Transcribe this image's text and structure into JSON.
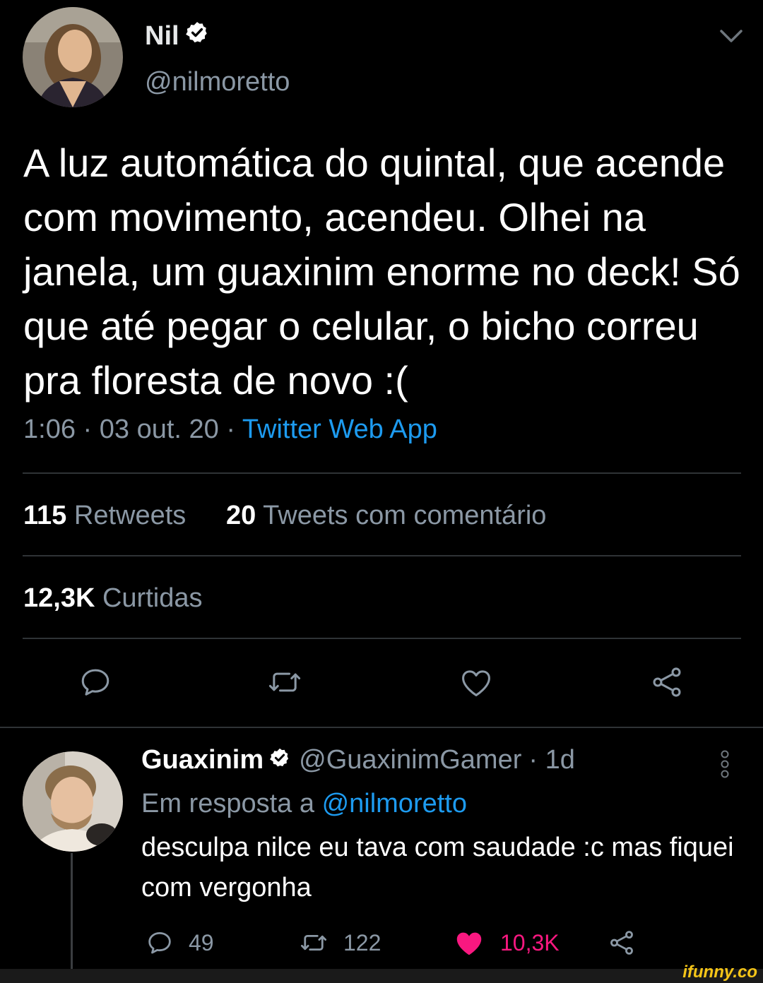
{
  "main_tweet": {
    "author_name": "Nil",
    "author_handle": "@nilmoretto",
    "text": "A luz automática do quintal, que acende com movimento, acendeu. Olhei na janela, um guaxinim enorme no deck! Só que até pegar o celular, o bicho correu pra floresta de novo :(",
    "time": "1:06",
    "date": "03 out. 20",
    "separator": "·",
    "source": "Twitter Web App",
    "retweets_count": "115",
    "retweets_label": "Retweets",
    "quote_count": "20",
    "quote_label": "Tweets com comentário",
    "likes_count": "12,3K",
    "likes_label": "Curtidas"
  },
  "reply": {
    "author_name": "Guaxinim",
    "author_handle": "@GuaxinimGamer",
    "age": "· 1d",
    "reply_to_label": "Em resposta a",
    "reply_to_handle": "@nilmoretto",
    "text": "desculpa nilce eu tava com saudade :c mas fiquei com vergonha",
    "reply_count": "49",
    "retweet_count": "122",
    "like_count": "10,3K"
  },
  "watermark": "ifunny.co",
  "colors": {
    "background": "#000000",
    "link": "#1d9bf0",
    "secondary_text": "#8b98a5",
    "like": "#f91880",
    "divider": "#2f3336"
  },
  "icons": [
    "chevron-down-icon",
    "verified-badge-icon",
    "reply-icon",
    "retweet-icon",
    "like-icon",
    "share-icon",
    "more-icon"
  ]
}
